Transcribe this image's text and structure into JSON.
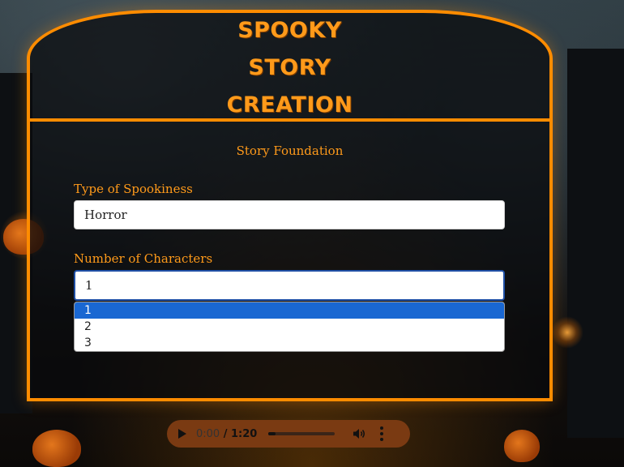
{
  "page": {
    "title_line1": "SPOOKY STORY",
    "title_line2": "CREATION"
  },
  "form": {
    "section_title": "Story Foundation",
    "spookiness": {
      "label": "Type of Spookiness",
      "value": "Horror"
    },
    "characters": {
      "label": "Number of Characters",
      "value": "1",
      "options": [
        "1",
        "2",
        "3"
      ],
      "highlighted_index": 0
    }
  },
  "audio": {
    "current_time": "0:00",
    "separator": " / ",
    "total_time": "1:20",
    "progress": 0.0,
    "icons": [
      "play-icon",
      "volume-icon",
      "more-options-icon"
    ]
  },
  "colors": {
    "accent": "#ff8c00",
    "title_text": "#ff9a1a",
    "option_highlight": "#1967d2",
    "audio_bg": "#7a3a12"
  }
}
